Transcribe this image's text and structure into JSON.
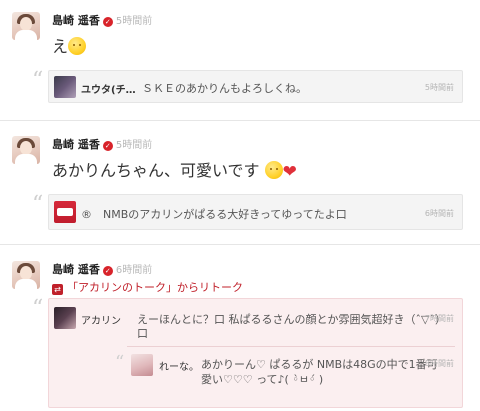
{
  "posts": [
    {
      "author": "島崎 遥香",
      "time": "5時間前",
      "text": "え",
      "quote": {
        "name": "ユウタ(チ…",
        "text": "ＳＫＥのあかりんもよろしくね。",
        "time": "5時間前"
      }
    },
    {
      "author": "島崎 遥香",
      "time": "5時間前",
      "text": "あかりんちゃん、可愛いです",
      "quote": {
        "name": "",
        "text": "®　NMBのアカリンがぱるる大好きってゆってたよ口",
        "time": "6時間前"
      }
    },
    {
      "author": "島崎 遥香",
      "time": "6時間前",
      "retalk": "「アカリンのトーク」からリトーク",
      "retalk_quote": {
        "name": "アカリン",
        "text_line1": "えーほんとに？口 私ぱるるさんの顔とか雰囲気超好き（ˆ▽ˆ）",
        "text_line2": "口",
        "time": "7時間前",
        "nested": {
          "name": "れーな。",
          "text_line1": "あかりーん♡ ぱるるが NMBは48Gの中で1番可",
          "text_line2": "愛い♡♡♡ って♪( ◦̀ㅂ◦́ )",
          "time": "8時間前"
        }
      }
    }
  ],
  "colors": {
    "accent": "#c0202a",
    "verified": "#d8232a",
    "quote_bg": "#f4f4f4",
    "retalk_bg": "#fbeff0"
  }
}
